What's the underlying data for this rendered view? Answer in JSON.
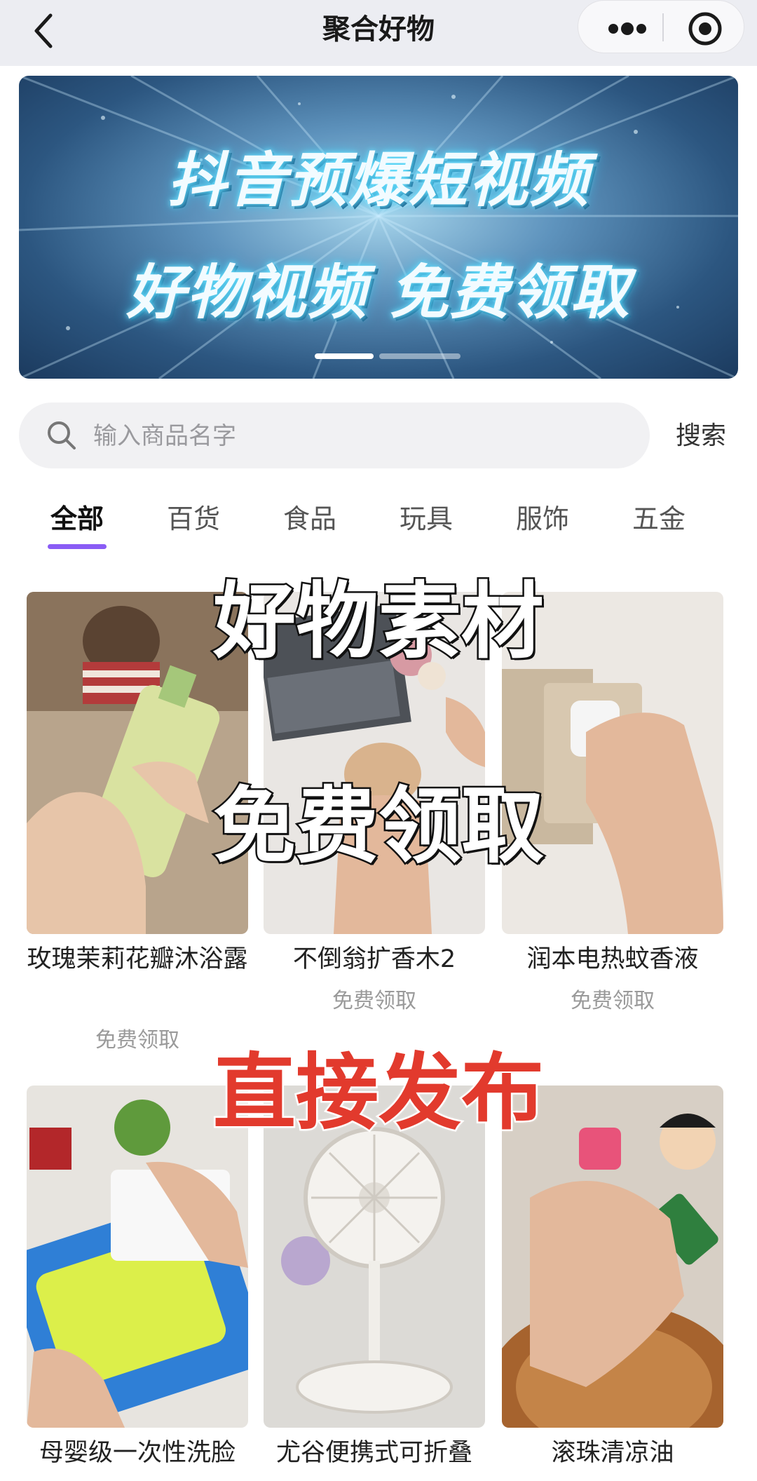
{
  "nav": {
    "title": "聚合好物"
  },
  "banner": {
    "line1": "抖音预爆短视频",
    "line2": "好物视频 免费领取"
  },
  "search": {
    "placeholder": "输入商品名字",
    "button_label": "搜索"
  },
  "tabs": [
    {
      "label": "全部",
      "active": true
    },
    {
      "label": "百货",
      "active": false
    },
    {
      "label": "食品",
      "active": false
    },
    {
      "label": "玩具",
      "active": false
    },
    {
      "label": "服饰",
      "active": false
    },
    {
      "label": "五金",
      "active": false
    }
  ],
  "products": [
    {
      "title": "玫瑰茉莉花瓣沐浴露",
      "tag": "免费领取"
    },
    {
      "title": "不倒翁扩香木2",
      "tag": "免费领取"
    },
    {
      "title": "润本电热蚊香液",
      "tag": "免费领取"
    },
    {
      "title": "母婴级一次性洗脸",
      "tag": ""
    },
    {
      "title": "尤谷便携式可折叠",
      "tag": ""
    },
    {
      "title": "滚珠清凉油",
      "tag": ""
    }
  ],
  "overlay": {
    "line1": "好物素材",
    "line2": "免费领取",
    "line3": "直接发布"
  },
  "colors": {
    "accent": "#8a5cf5",
    "nav_bg": "#ecedf2",
    "overlay_red": "#e23a2d"
  }
}
